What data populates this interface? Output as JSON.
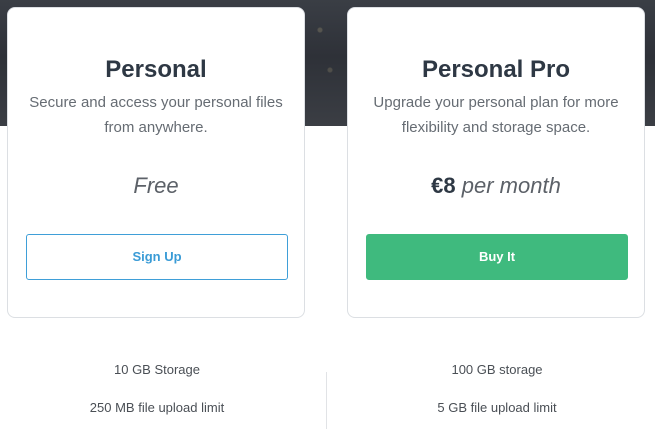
{
  "plans": [
    {
      "name": "Personal",
      "description": "Secure and access your personal files from anywhere.",
      "price": "Free",
      "button_label": "Sign Up",
      "features": [
        "10 GB Storage",
        "250 MB file upload limit"
      ]
    },
    {
      "name": "Personal Pro",
      "description": "Upgrade your personal plan for more flexibility and storage space.",
      "price_amount": "€8",
      "price_period": "per month",
      "button_label": "Buy It",
      "features": [
        "100 GB storage",
        "5 GB file upload limit"
      ]
    }
  ],
  "colors": {
    "accent_blue": "#3a9bd6",
    "accent_green": "#3fba7e",
    "title_text": "#2e3844"
  }
}
